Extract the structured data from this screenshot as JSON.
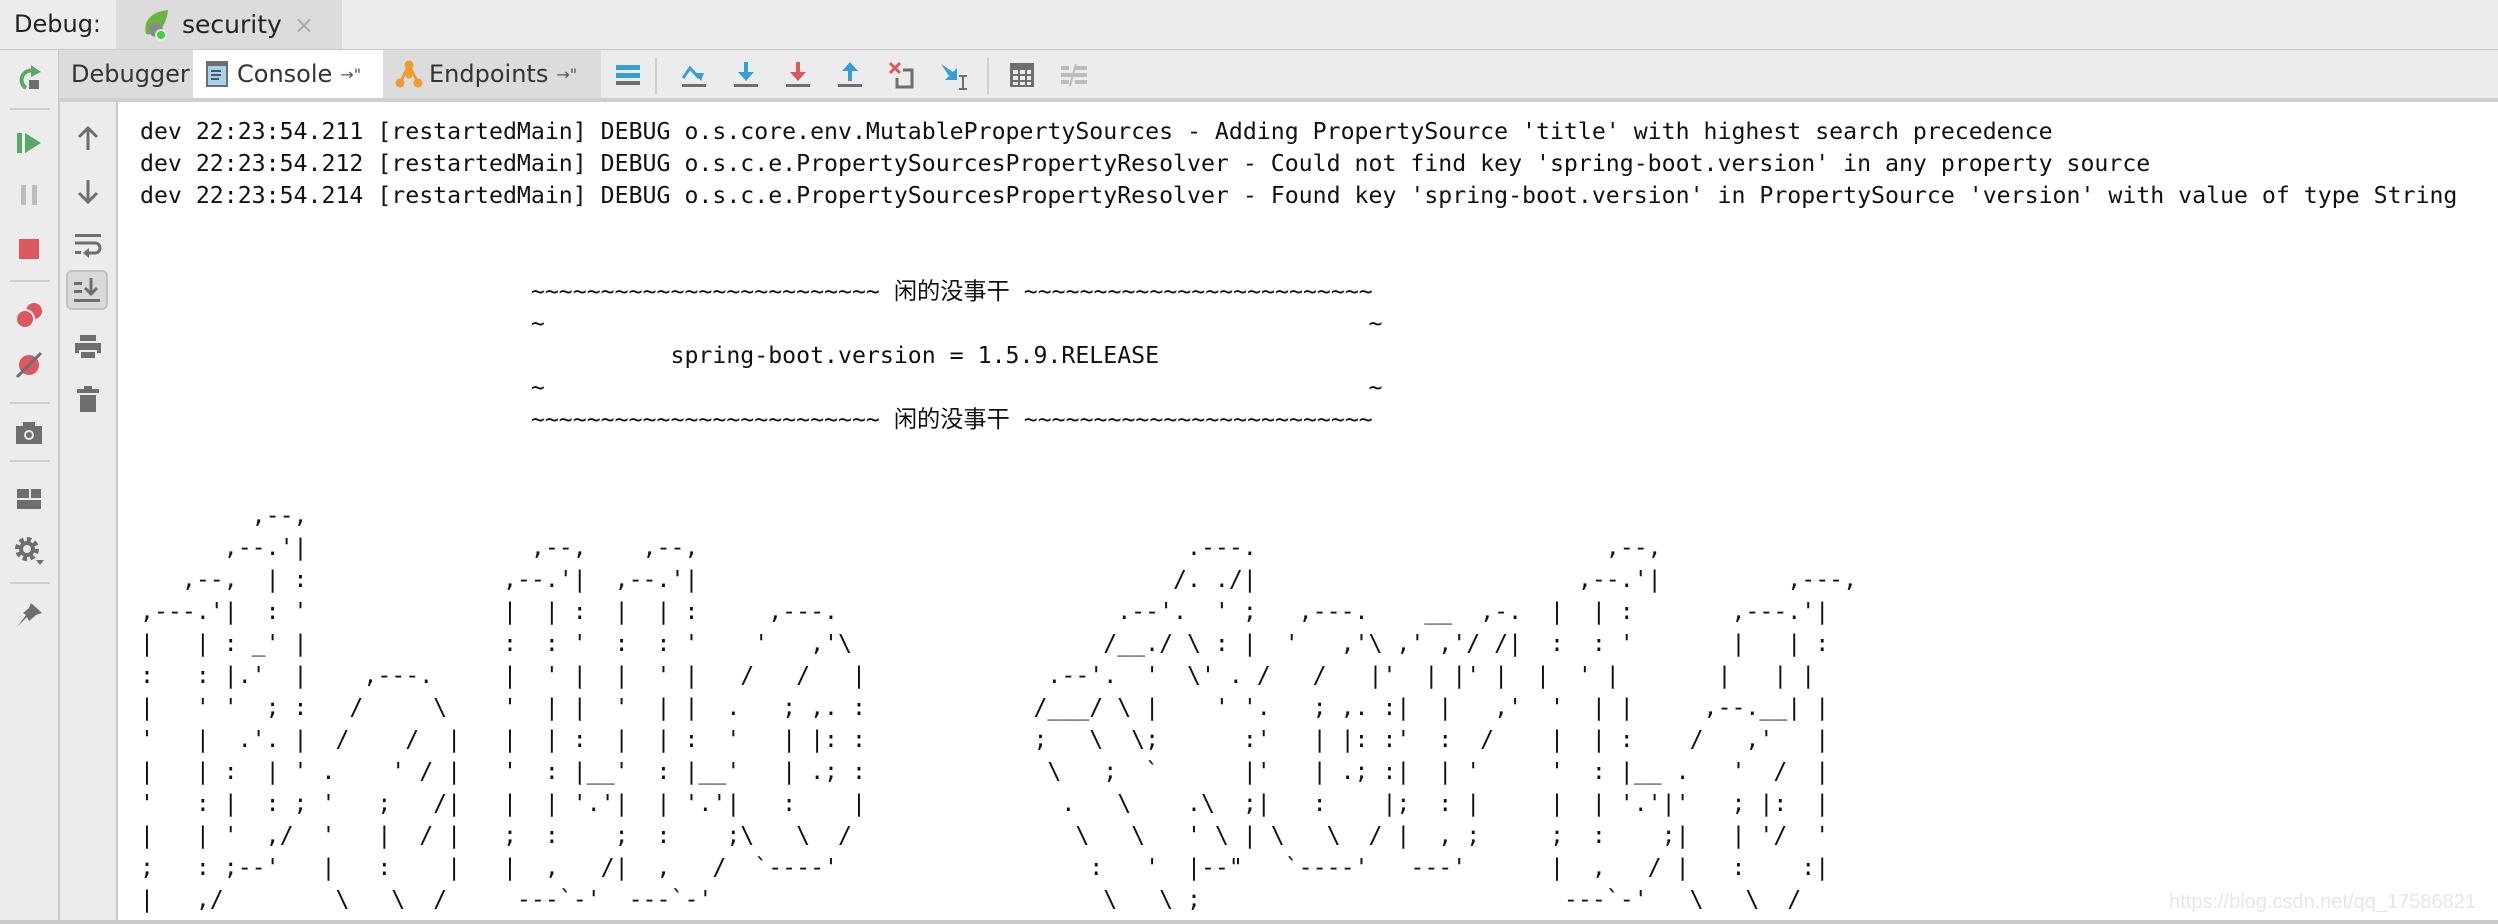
{
  "header": {
    "debug_label": "Debug:",
    "run_tab": {
      "label": "security",
      "icon": "spring-boot-icon",
      "close": "×"
    }
  },
  "toolbar": {
    "tabs": [
      {
        "label": "Debugger"
      },
      {
        "label": "Console",
        "icon": "console-icon",
        "pin": "→\""
      },
      {
        "label": "Endpoints",
        "icon": "endpoints-icon",
        "pin": "→\""
      }
    ],
    "icons": [
      "show-execution-point-icon",
      "step-over-icon",
      "step-into-icon",
      "force-step-into-icon",
      "step-out-icon",
      "drop-frame-icon",
      "run-to-cursor-icon",
      "evaluate-expression-icon",
      "trace-icon"
    ]
  },
  "left_actions": [
    "rerun-icon",
    "resume-icon",
    "pause-icon",
    "stop-icon",
    "view-breakpoints-icon",
    "mute-breakpoints-icon",
    "snapshot-icon",
    "layout-icon",
    "settings-icon",
    "pin-icon"
  ],
  "console_actions": [
    "up-icon",
    "down-icon",
    "soft-wrap-icon",
    "scroll-to-end-icon",
    "print-icon",
    "clear-icon"
  ],
  "colors": {
    "green": "#59a869",
    "red": "#db5860",
    "blue": "#389fd6",
    "gray": "#6e6e6e"
  },
  "console": {
    "lines": [
      "dev 22:23:54.211 [restartedMain] DEBUG o.s.core.env.MutablePropertySources - Adding PropertySource 'title' with highest search precedence",
      "dev 22:23:54.212 [restartedMain] DEBUG o.s.c.e.PropertySourcesPropertyResolver - Could not find key 'spring-boot.version' in any property source",
      "dev 22:23:54.214 [restartedMain] DEBUG o.s.c.e.PropertySourcesPropertyResolver - Found key 'spring-boot.version' in PropertySource 'version' with value of type String",
      "",
      "",
      "                            ~~~~~~~~~~~~~~~~~~~~~~~~~ 闲的没事干 ~~~~~~~~~~~~~~~~~~~~~~~~~",
      "                            ~                                                           ~",
      "                                      spring-boot.version = 1.5.9.RELEASE",
      "                            ~                                                           ~",
      "                            ~~~~~~~~~~~~~~~~~~~~~~~~~ 闲的没事干 ~~~~~~~~~~~~~~~~~~~~~~~~~",
      "",
      "",
      "        ,--,",
      "      ,--.'|                ,--,    ,--,                                   .---.                         ,--,",
      "   ,--,  | :              ,--.'|  ,--.'|                                  /. ./|                       ,--.'|         ,---,",
      ",---.'|  : '              |  | :  |  | :     ,---.                    .--'.  ' ;   ,---.    __  ,-.  |  | :       ,---.'|",
      "|   | : _' |              :  : '  :  : '    '   ,'\\                  /__./ \\ : |  '   ,'\\ ,' ,'/ /|  :  : '       |   | :",
      ":   : |.'  |    ,---.     |  ' |  |  ' |   /   /   |             .--'.  '  \\' . /   /   |'  | |' |  |  ' |       |   | |",
      "|   ' '  ; :   /     \\    '  | |  '  | |  .   ; ,. :            /___/ \\ |    ' '.   ; ,. :|  |   ,'  '  | |     ,--.__| |",
      "'   |  .'. |  /    /  |   |  | :  |  | :  '   | |: :            ;   \\  \\;      :'   | |: :'  :  /    |  | :    /   ,'   |",
      "|   | :  | ' .    ' / |   '  : |__'  : |__'   | .; :             \\   ;  `      |'   | .; :|  | '     '  : |__ .   '  /  |",
      "'   : |  : ; '   ;   /|   |  | '.'|  | '.'|   :    |              .   \\    .\\  ;|   :    |;  : |     |  | '.'|'   ; |:  |",
      "|   | '  ,/  '   |  / |   ;  :    ;  :    ;\\   \\  /                \\   \\   ' \\ | \\   \\  / |  , ;     ;  :    ;|   | '/  '",
      ";   : ;--'   |   :    |   |  ,   /|  ,   /  `----'                  :   '  |--\"   `----'   ---'      |  ,   / |   :    :|",
      "|   ,/        \\   \\  /     ---`-'  ---`-'                            \\   \\ ;                          ---`-'   \\   \\  /"
    ]
  },
  "watermark": "https://blog.csdn.net/qq_17586821"
}
